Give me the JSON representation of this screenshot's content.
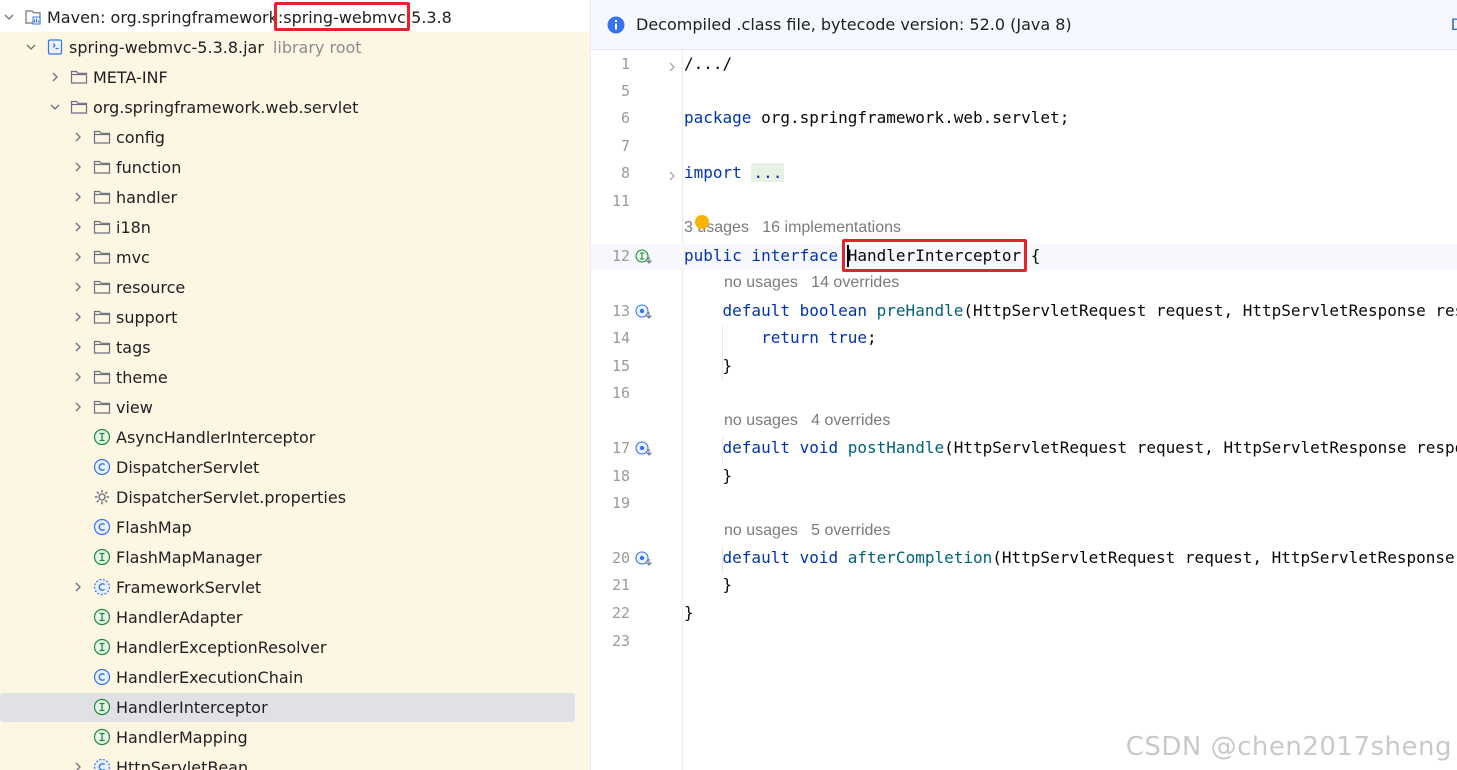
{
  "tree": {
    "rows": [
      {
        "label": "Maven: org.springframework:spring-webmvc:5.3.8",
        "type": "library",
        "expanded": true,
        "level": 0
      },
      {
        "label": "spring-webmvc-5.3.8.jar",
        "extra": "library root",
        "type": "jar",
        "expanded": true,
        "level": 1
      },
      {
        "label": "META-INF",
        "type": "folder",
        "expanded": false,
        "level": 2
      },
      {
        "label": "org.springframework.web.servlet",
        "type": "folder",
        "expanded": true,
        "level": 2
      },
      {
        "label": "config",
        "type": "folder",
        "expanded": false,
        "level": 3
      },
      {
        "label": "function",
        "type": "folder",
        "expanded": false,
        "level": 3
      },
      {
        "label": "handler",
        "type": "folder",
        "expanded": false,
        "level": 3
      },
      {
        "label": "i18n",
        "type": "folder",
        "expanded": false,
        "level": 3
      },
      {
        "label": "mvc",
        "type": "folder",
        "expanded": false,
        "level": 3
      },
      {
        "label": "resource",
        "type": "folder",
        "expanded": false,
        "level": 3
      },
      {
        "label": "support",
        "type": "folder",
        "expanded": false,
        "level": 3
      },
      {
        "label": "tags",
        "type": "folder",
        "expanded": false,
        "level": 3
      },
      {
        "label": "theme",
        "type": "folder",
        "expanded": false,
        "level": 3
      },
      {
        "label": "view",
        "type": "folder",
        "expanded": false,
        "level": 3
      },
      {
        "label": "AsyncHandlerInterceptor",
        "type": "interface",
        "level": 3
      },
      {
        "label": "DispatcherServlet",
        "type": "class",
        "level": 3
      },
      {
        "label": "DispatcherServlet.properties",
        "type": "properties",
        "level": 3
      },
      {
        "label": "FlashMap",
        "type": "class",
        "level": 3
      },
      {
        "label": "FlashMapManager",
        "type": "interface",
        "level": 3
      },
      {
        "label": "FrameworkServlet",
        "type": "abstract-class",
        "expanded": false,
        "level": 3
      },
      {
        "label": "HandlerAdapter",
        "type": "interface",
        "level": 3
      },
      {
        "label": "HandlerExceptionResolver",
        "type": "interface",
        "level": 3
      },
      {
        "label": "HandlerExecutionChain",
        "type": "class",
        "level": 3
      },
      {
        "label": "HandlerInterceptor",
        "type": "interface",
        "level": 3,
        "selected": true
      },
      {
        "label": "HandlerMapping",
        "type": "interface",
        "level": 3
      },
      {
        "label": "HttpServletBean",
        "type": "abstract-class",
        "expanded": false,
        "level": 3
      }
    ]
  },
  "banner": {
    "text": "Decompiled .class file, bytecode version: 52.0 (Java 8)",
    "link": "D"
  },
  "editor": {
    "lines": [
      {
        "n": "1",
        "fold": true,
        "parts": [
          [
            "",
            "/.../"
          ]
        ]
      },
      {
        "n": "5",
        "parts": []
      },
      {
        "n": "6",
        "parts": [
          [
            "kw",
            "package"
          ],
          [
            "",
            " org.springframework.web.servlet;"
          ]
        ]
      },
      {
        "n": "7",
        "parts": []
      },
      {
        "n": "8",
        "fold": true,
        "parts": [
          [
            "kw",
            "import"
          ],
          [
            "",
            " "
          ],
          [
            "fold",
            "..."
          ]
        ]
      },
      {
        "n": "11",
        "parts": []
      },
      {
        "hint": "3 usages   16 implementations",
        "hint_indent": 0
      },
      {
        "n": "12",
        "icon": "interface-implemented",
        "current": true,
        "parts": [
          [
            "kw",
            "public interface "
          ],
          [
            "",
            "HandlerInterceptor {"
          ]
        ]
      },
      {
        "hint": "no usages   14 overrides",
        "hint_indent": 1
      },
      {
        "n": "13",
        "icon": "method-overridden",
        "parts": [
          [
            "",
            "    "
          ],
          [
            "kw",
            "default boolean "
          ],
          [
            "fn",
            "preHandle"
          ],
          [
            "",
            "(HttpServletRequest request, HttpServletResponse response, Object handler) throws Exception {"
          ]
        ]
      },
      {
        "n": "14",
        "parts": [
          [
            "",
            "        "
          ],
          [
            "kw",
            "return true"
          ],
          [
            "",
            ";"
          ]
        ]
      },
      {
        "n": "15",
        "parts": [
          [
            "",
            "    }"
          ]
        ]
      },
      {
        "n": "16",
        "parts": []
      },
      {
        "hint": "no usages   4 overrides",
        "hint_indent": 1
      },
      {
        "n": "17",
        "icon": "method-overridden",
        "parts": [
          [
            "",
            "    "
          ],
          [
            "kw",
            "default void "
          ],
          [
            "fn",
            "postHandle"
          ],
          [
            "",
            "(HttpServletRequest request, HttpServletResponse response, Object handler, ModelAndView modelAndView) throws Exception {"
          ]
        ]
      },
      {
        "n": "18",
        "parts": [
          [
            "",
            "    }"
          ]
        ]
      },
      {
        "n": "19",
        "parts": []
      },
      {
        "hint": "no usages   5 overrides",
        "hint_indent": 1
      },
      {
        "n": "20",
        "icon": "method-overridden",
        "parts": [
          [
            "",
            "    "
          ],
          [
            "kw",
            "default void "
          ],
          [
            "fn",
            "afterCompletion"
          ],
          [
            "",
            "(HttpServletRequest request, HttpServletResponse response, Object handler, Exception ex) throws Exception {"
          ]
        ]
      },
      {
        "n": "21",
        "parts": [
          [
            "",
            "    }"
          ]
        ]
      },
      {
        "n": "22",
        "parts": [
          [
            "",
            "}"
          ]
        ]
      },
      {
        "n": "23",
        "parts": []
      }
    ]
  },
  "watermark": "CSDN @chen2017sheng",
  "colors": {
    "highlight_box": "#e8212a",
    "keyword": "#0033b3",
    "method": "#00627a",
    "tree_background": "#fdf6e3",
    "selection": "#dfe1e5"
  }
}
